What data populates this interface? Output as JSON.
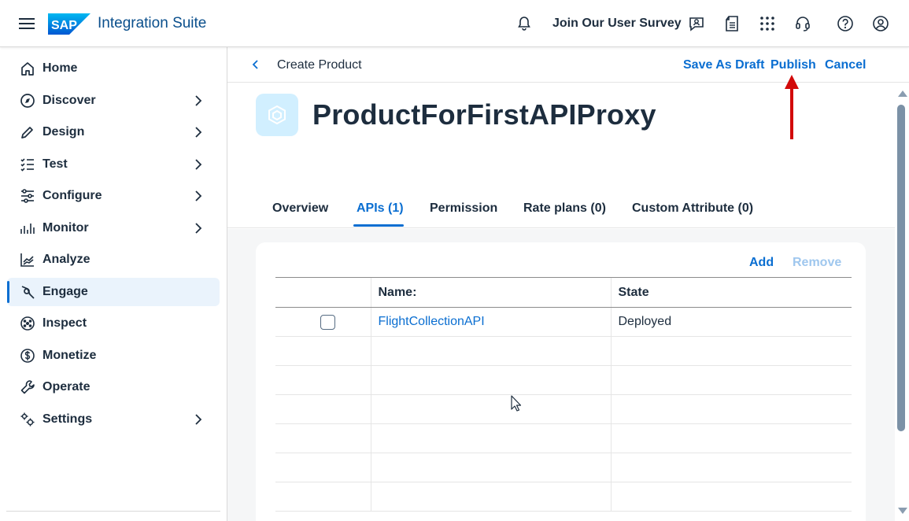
{
  "shell": {
    "logo_text": "SAP",
    "product_name": "Integration Suite",
    "survey_link": "Join Our User Survey",
    "icons": [
      "menu-icon",
      "notification-bell-icon",
      "feedback-icon",
      "documentation-icon",
      "product-switch-grid-icon",
      "support-headset-icon",
      "help-icon",
      "user-profile-icon"
    ]
  },
  "sidebar": {
    "items": [
      {
        "label": "Home",
        "icon": "home-icon",
        "has_children": false
      },
      {
        "label": "Discover",
        "icon": "compass-icon",
        "has_children": true
      },
      {
        "label": "Design",
        "icon": "pencil-icon",
        "has_children": true
      },
      {
        "label": "Test",
        "icon": "checklist-icon",
        "has_children": true
      },
      {
        "label": "Configure",
        "icon": "sliders-icon",
        "has_children": true
      },
      {
        "label": "Monitor",
        "icon": "bar-monitor-icon",
        "has_children": true
      },
      {
        "label": "Analyze",
        "icon": "line-chart-icon",
        "has_children": false
      },
      {
        "label": "Engage",
        "icon": "engage-icon",
        "has_children": false,
        "active": true
      },
      {
        "label": "Inspect",
        "icon": "inspect-icon",
        "has_children": false
      },
      {
        "label": "Monetize",
        "icon": "dollar-icon",
        "has_children": false
      },
      {
        "label": "Operate",
        "icon": "wrench-icon",
        "has_children": false
      },
      {
        "label": "Settings",
        "icon": "gears-icon",
        "has_children": true
      }
    ]
  },
  "header": {
    "breadcrumb": "Create Product",
    "save_draft": "Save As Draft",
    "publish": "Publish",
    "cancel": "Cancel"
  },
  "object": {
    "title": "ProductForFirstAPIProxy",
    "icon": "product-cube-icon"
  },
  "tabs": [
    {
      "label": "Overview"
    },
    {
      "label": "APIs (1)",
      "active": true
    },
    {
      "label": "Permission"
    },
    {
      "label": "Rate plans (0)"
    },
    {
      "label": "Custom Attribute (0)"
    }
  ],
  "apis_table": {
    "add_label": "Add",
    "remove_label": "Remove",
    "columns": [
      "",
      "Name:",
      "State"
    ],
    "rows": [
      {
        "selected": false,
        "name": "FlightCollectionAPI",
        "state": "Deployed"
      }
    ],
    "empty_rows": 6
  },
  "colors": {
    "accent": "#0a6ed1",
    "annotation_arrow": "#d20a0a",
    "active_nav_bg": "#eaf3fc",
    "text": "#1d2d3e"
  }
}
